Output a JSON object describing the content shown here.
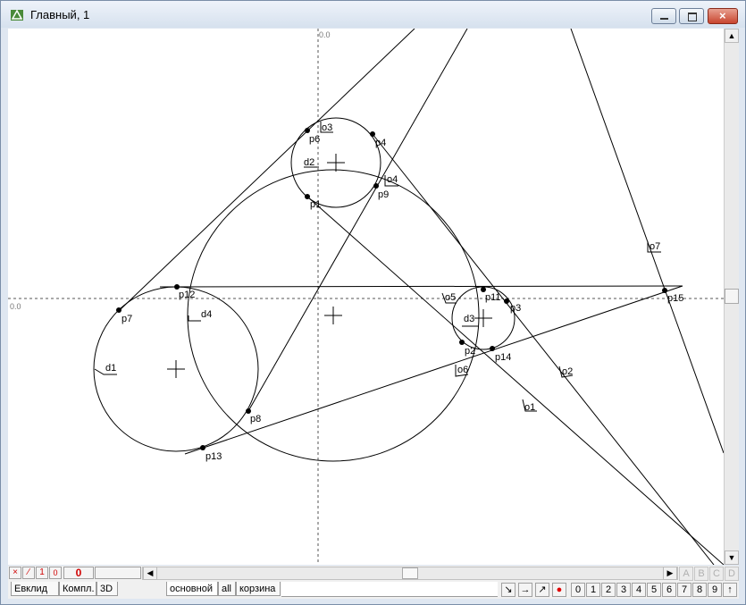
{
  "window": {
    "title": "Главный, 1"
  },
  "axes": {
    "x_origin_label": "0.0",
    "y_origin_label": "0.0"
  },
  "labels": {
    "p1": "p1",
    "p3": "p3",
    "p4": "p4",
    "p6": "p6",
    "p7": "p7",
    "p8": "p8",
    "p9": "p9",
    "p11": "p11",
    "p12": "p12",
    "p13": "p13",
    "p14": "p14",
    "p15": "p15",
    "p2": "p2",
    "d1": "d1",
    "d2": "d2",
    "d3": "d3",
    "d4": "d4",
    "o1": "o1",
    "o2": "o2",
    "o3": "o3",
    "o4": "o4",
    "o5": "o5",
    "o6": "o6",
    "o7": "o7"
  },
  "statusbar": {
    "small_buttons": [
      "×",
      "∕",
      "1",
      "0"
    ],
    "counter": "0",
    "tabs_left": [
      "Евклид",
      "Компл.",
      "3D"
    ],
    "tabs_main": [
      "основной",
      "all",
      "корзина"
    ],
    "tools": [
      "↘",
      "→",
      "↗",
      "●"
    ],
    "numbers": [
      "0",
      "1",
      "2",
      "3",
      "4",
      "5",
      "6",
      "7",
      "8",
      "9",
      "↑"
    ],
    "letters": [
      "A",
      "B",
      "C",
      "D"
    ]
  },
  "colors": {
    "accent_red": "#d00000"
  }
}
